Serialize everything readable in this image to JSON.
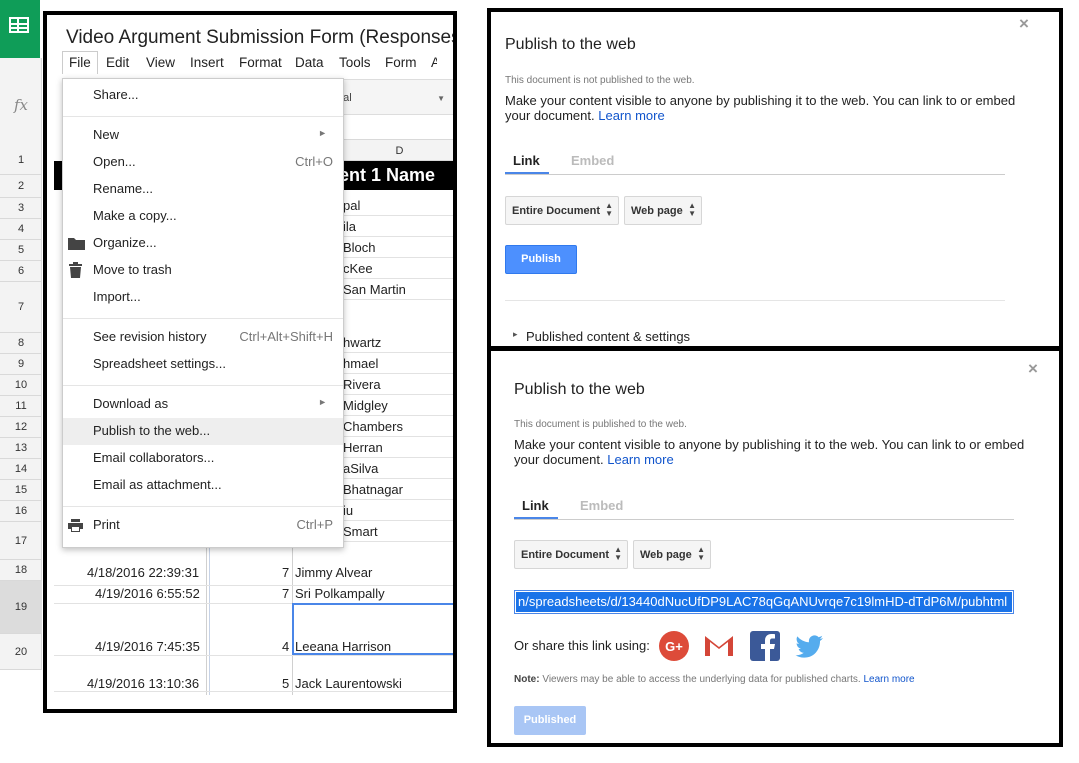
{
  "spreadsheet": {
    "title": "Video Argument Submission Form (Responses)",
    "formula_icon": "fx",
    "menu_bar": [
      "File",
      "Edit",
      "View",
      "Insert",
      "Format",
      "Data",
      "Tools",
      "Form",
      "A"
    ],
    "font_name": "rial",
    "column_d_label": "D",
    "header_text": "ent 1 Name",
    "row_numbers": [
      "1",
      "2",
      "3",
      "4",
      "5",
      "6",
      "7",
      "8",
      "9",
      "10",
      "11",
      "12",
      "13",
      "14",
      "15",
      "16",
      "17",
      "18",
      "19",
      "20"
    ],
    "d_fragments": [
      "pal",
      "ila",
      "Bloch",
      "cKee",
      "San Martin",
      "hwartz",
      "hmael",
      "Rivera",
      "Midgley",
      "Chambers",
      "Herran",
      "aSilva",
      "Bhatnagar",
      "iu",
      "Smart"
    ],
    "rows": [
      {
        "date": "4/18/2016 22:39:31",
        "count": "7",
        "name": "Jimmy Alvear"
      },
      {
        "date": "4/19/2016 6:55:52",
        "count": "7",
        "name": "Sri Polkampally"
      },
      {
        "date": "4/19/2016 7:45:35",
        "count": "4",
        "name": "Leeana Harrison"
      },
      {
        "date": "4/19/2016 13:10:36",
        "count": "5",
        "name": "Jack Laurentowski"
      }
    ]
  },
  "file_menu": {
    "items": [
      {
        "label": "Share...",
        "shortcut": ""
      },
      {
        "label": "New",
        "shortcut": "",
        "submenu": "►"
      },
      {
        "label": "Open...",
        "shortcut": "Ctrl+O"
      },
      {
        "label": "Rename...",
        "shortcut": ""
      },
      {
        "label": "Make a copy...",
        "shortcut": ""
      },
      {
        "label": "Organize...",
        "shortcut": "",
        "icon": "folder-icon"
      },
      {
        "label": "Move to trash",
        "shortcut": "",
        "icon": "trash-icon"
      },
      {
        "label": "Import...",
        "shortcut": ""
      },
      {
        "label": "See revision history",
        "shortcut": "Ctrl+Alt+Shift+H"
      },
      {
        "label": "Spreadsheet settings...",
        "shortcut": ""
      },
      {
        "label": "Download as",
        "shortcut": "",
        "submenu": "►"
      },
      {
        "label": "Publish to the web...",
        "shortcut": ""
      },
      {
        "label": "Email collaborators...",
        "shortcut": ""
      },
      {
        "label": "Email as attachment...",
        "shortcut": ""
      },
      {
        "label": "Print",
        "shortcut": "Ctrl+P",
        "icon": "printer-icon"
      }
    ]
  },
  "dialog_unpublished": {
    "title": "Publish to the web",
    "close": "×",
    "status": "This document is not published to the web.",
    "description": "Make your content visible to anyone by publishing it to the web. You can link to or embed your document.",
    "learn_more": "Learn more",
    "tab_link": "Link",
    "tab_embed": "Embed",
    "scope_select": "Entire Document",
    "format_select": "Web page",
    "publish_button": "Publish",
    "settings_arrow": "▸",
    "settings_label": "Published content & settings"
  },
  "dialog_published": {
    "title": "Publish to the web",
    "close": "×",
    "status": "This document is published to the web.",
    "description": "Make your content visible to anyone by publishing it to the web. You can link to or embed your document.",
    "learn_more": "Learn more",
    "tab_link": "Link",
    "tab_embed": "Embed",
    "scope_select": "Entire Document",
    "format_select": "Web page",
    "url": "n/spreadsheets/d/13440dNucUfDP9LAC78qGqANUvrqe7c19lmHD-dTdP6M/pubhtml",
    "share_label": "Or share this link using:",
    "share_icons": [
      "google-plus-icon",
      "gmail-icon",
      "facebook-icon",
      "twitter-icon"
    ],
    "note_label": "Note:",
    "note_text": "Viewers may be able to access the underlying data for published charts.",
    "note_learn_more": "Learn more",
    "published_button": "Published"
  },
  "colors": {
    "sheets_green": "#0f9d58",
    "accent_blue": "#4d90fe",
    "link_blue": "#1155cc",
    "selection_blue": "#1a73e8",
    "disabled_blue": "#a9c6f5"
  }
}
